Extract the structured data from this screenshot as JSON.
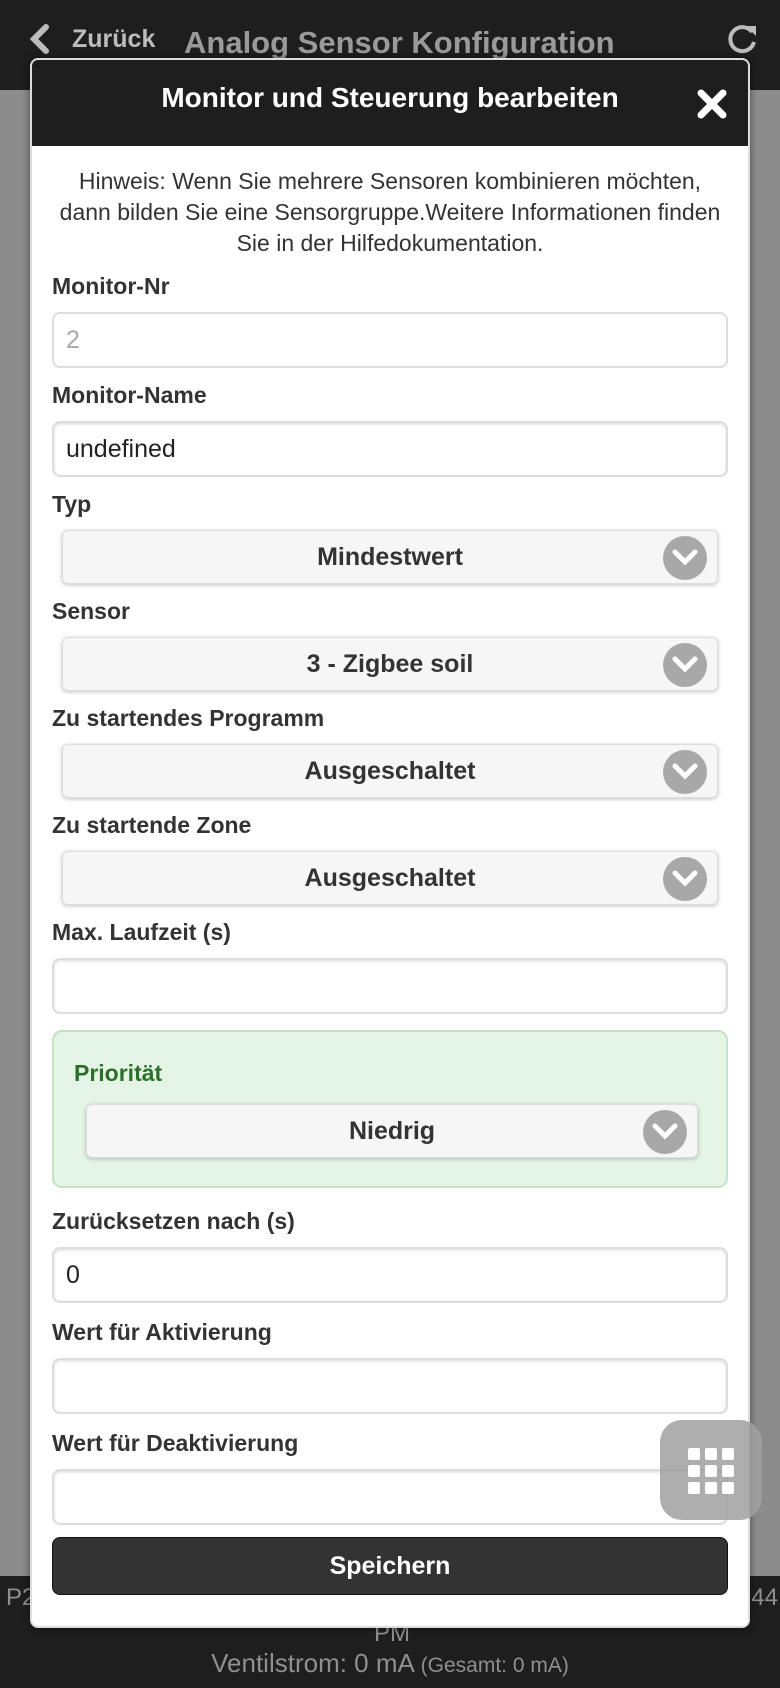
{
  "background": {
    "back_label": "Zurück",
    "page_title": "Analog Sensor Konfiguration",
    "footer_left": "P2",
    "footer_right": "44",
    "footer_pm": "PM",
    "valve_current": "Ventilstrom: 0 mA",
    "valve_total": "(Gesamt: 0 mA)"
  },
  "modal": {
    "title": "Monitor und Steuerung bearbeiten",
    "hint": "Hinweis: Wenn Sie mehrere Sensoren kombinieren möchten, dann bilden Sie eine Sensorgruppe.Weitere Informationen finden Sie in der Hilfedokumentation.",
    "fields": {
      "monitor_nr": {
        "label": "Monitor-Nr",
        "value": "2"
      },
      "monitor_name": {
        "label": "Monitor-Name",
        "value": "undefined"
      },
      "typ": {
        "label": "Typ",
        "selected": "Mindestwert"
      },
      "sensor": {
        "label": "Sensor",
        "selected": "3 - Zigbee soil"
      },
      "program": {
        "label": "Zu startendes Programm",
        "selected": "Ausgeschaltet"
      },
      "zone": {
        "label": "Zu startende Zone",
        "selected": "Ausgeschaltet"
      },
      "max_runtime": {
        "label": "Max. Laufzeit (s)",
        "value": ""
      },
      "priority": {
        "label": "Priorität",
        "selected": "Niedrig"
      },
      "reset_after": {
        "label": "Zurücksetzen nach (s)",
        "value": "0"
      },
      "activation_value": {
        "label": "Wert für Aktivierung",
        "value": ""
      },
      "deactivation_value": {
        "label": "Wert für Deaktivierung",
        "value": ""
      }
    },
    "save_label": "Speichern"
  },
  "colors": {
    "header_bg": "#1e1e1e",
    "priority_bg": "#e5f5e5",
    "priority_text": "#2c6e2c",
    "save_bg": "#333333"
  },
  "icons": [
    "chevron-left-icon",
    "refresh-icon",
    "close-icon",
    "chevron-down-icon",
    "keypad-grid-icon"
  ]
}
